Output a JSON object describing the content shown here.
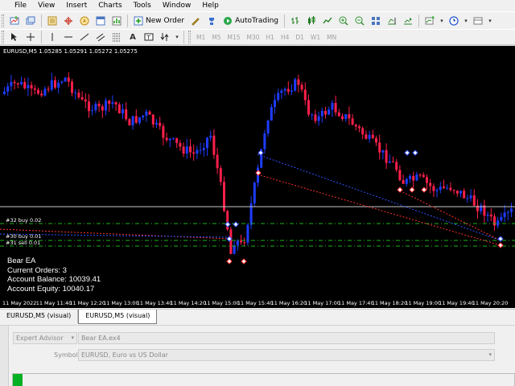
{
  "menu": [
    "File",
    "View",
    "Insert",
    "Charts",
    "Tools",
    "Window",
    "Help"
  ],
  "toolbar": {
    "new_order_label": "New Order",
    "autotrading_label": "AutoTrading"
  },
  "timeframes": [
    "M1",
    "M5",
    "M15",
    "M30",
    "H1",
    "H4",
    "D1",
    "W1",
    "MN"
  ],
  "chart": {
    "header": "EURUSD,M5  1.05285 1.05291 1.05272 1.05275",
    "order_labels": [
      "#32 buy 0.02",
      "#30 buy 0.01",
      "#31 sell 0.01"
    ],
    "ea_info": {
      "name": "Bear EA",
      "current_orders": "Current Orders:  3",
      "balance": "Account Balance:  10039.41",
      "equity": "Account Equity:  10040.17"
    },
    "time_labels": [
      "11 May 2022",
      "11 May 11:40",
      "11 May 12:20",
      "11 May 13:00",
      "11 May 13:40",
      "11 May 14:20",
      "11 May 15:00",
      "11 May 15:40",
      "11 May 16:20",
      "11 May 17:00",
      "11 May 17:40",
      "11 May 18:20",
      "11 May 19:00",
      "11 May 19:40",
      "11 May 20:20"
    ],
    "colors": {
      "bull": "#1e3cff",
      "bear": "#ff1f4a",
      "background": "#000000"
    }
  },
  "tabs": [
    "EURUSD,M5 (visual)",
    "EURUSD,M5 (visual)"
  ],
  "tester": {
    "type_value": "Expert Advisor",
    "ea_file": "Bear EA.ex4",
    "symbol_label": "Symbol:",
    "symbol_value": "EURUSD, Euro vs US Dollar",
    "progress": 0.02
  }
}
